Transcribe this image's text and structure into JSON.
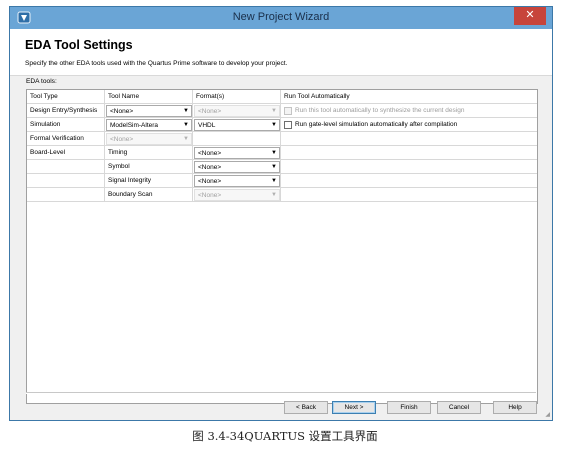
{
  "window": {
    "title": "New Project Wizard",
    "close_glyph": "✕"
  },
  "page": {
    "title": "EDA Tool Settings",
    "subtitle": "Specify the other EDA tools used with the Quartus Prime software to develop your project.",
    "eda_tools_label": "EDA tools:"
  },
  "table": {
    "headers": {
      "tool_type": "Tool Type",
      "tool_name": "Tool Name",
      "formats": "Format(s)",
      "run": "Run Tool Automatically"
    },
    "rows": [
      {
        "tool_type": "Design Entry/Synthesis",
        "tool_name": "<None>",
        "format": "<None>",
        "run_label": "Run this tool automatically to synthesize the current design",
        "checked": false
      },
      {
        "tool_type": "Simulation",
        "tool_name": "ModelSim-Altera",
        "format": "VHDL",
        "run_label": "Run gate-level simulation automatically after compilation",
        "checked": false
      },
      {
        "tool_type": "Formal Verification",
        "tool_name": "<None>"
      },
      {
        "tool_type": "Board-Level",
        "tool_name": "Timing",
        "format": "<None>"
      },
      {
        "tool_name": "Symbol",
        "format": "<None>"
      },
      {
        "tool_name": "Signal Integrity",
        "format": "<None>"
      },
      {
        "tool_name": "Boundary Scan",
        "format": "<None>"
      }
    ]
  },
  "buttons": {
    "back": "< Back",
    "next": "Next >",
    "finish": "Finish",
    "cancel": "Cancel",
    "help": "Help"
  },
  "caption": "图 3.4-34QUARTUS 设置工具界面",
  "icons": {
    "app": "app-icon",
    "dropdown": "chevron-down-icon"
  },
  "colors": {
    "titlebar": "#6aa5d6",
    "close": "#c7443b",
    "accent": "#3c7fb1"
  }
}
